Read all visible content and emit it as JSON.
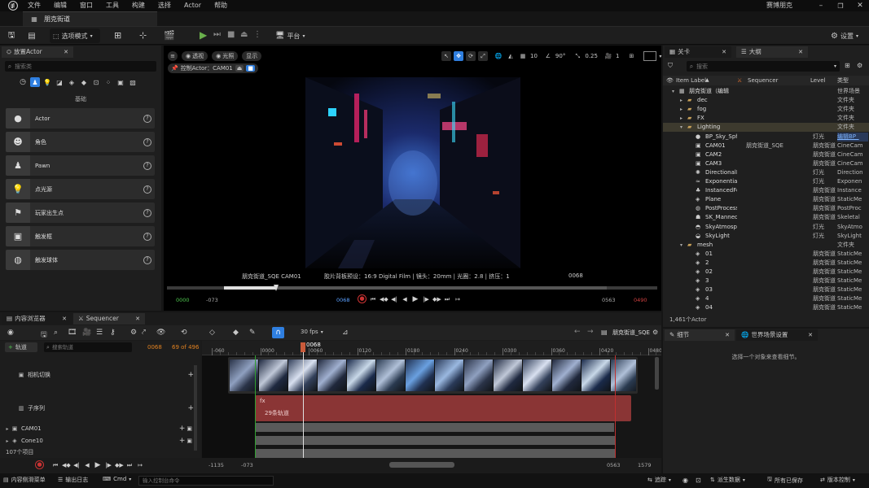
{
  "menu": [
    "文件",
    "编辑",
    "窗口",
    "工具",
    "构建",
    "选择",
    "Actor",
    "帮助"
  ],
  "project_name": "赛博朋克",
  "doc_tab": "朋克街道",
  "toolbar": {
    "mode": "选项模式",
    "platform": "平台",
    "settings": "设置"
  },
  "place_actor": {
    "tab": "放置Actor",
    "search_placeholder": "搜索类",
    "category": "基础",
    "items": [
      {
        "label": "Actor",
        "icon": "sphere-icon"
      },
      {
        "label": "角色",
        "icon": "character-icon"
      },
      {
        "label": "Pawn",
        "icon": "pawn-icon"
      },
      {
        "label": "点光源",
        "icon": "light-bulb-icon"
      },
      {
        "label": "玩家出生点",
        "icon": "player-start-icon"
      },
      {
        "label": "触发框",
        "icon": "trigger-box-icon"
      },
      {
        "label": "触发球体",
        "icon": "trigger-sphere-icon"
      }
    ]
  },
  "viewport": {
    "btn_perspective": "透视",
    "btn_lit": "光照",
    "btn_show": "显示",
    "grid_snap": "10",
    "rot_snap": "90°",
    "scale_snap": "0.25",
    "cam_speed": "1",
    "pilot_label": "控制Actor：CAM01",
    "cam_name": "朋克街道_SQE CAM01",
    "film_info": "胶片背板预设：16:9 Digital Film | 镜头：20mm | 光圈：2.8 | 挤压：1",
    "frame": "0068",
    "play_start": "0000",
    "play_in": "-073",
    "play_cur": "0068",
    "play_out": "0563",
    "play_end": "0490"
  },
  "outliner": {
    "tab_levels": "关卡",
    "tab_outliner": "大纲",
    "search_placeholder": "搜索",
    "col_label": "Item Label",
    "col_sequencer": "Sequencer",
    "col_level": "Level",
    "col_type": "类型",
    "rows": [
      {
        "indent": 0,
        "name": "朋克街道（编辑",
        "seq": "",
        "level": "",
        "type": "世界场景",
        "icon": "map-icon",
        "exp": "v"
      },
      {
        "indent": 1,
        "name": "dec",
        "seq": "",
        "level": "",
        "type": "文件夹",
        "icon": "folder-icon",
        "exp": ">"
      },
      {
        "indent": 1,
        "name": "fog",
        "seq": "",
        "level": "",
        "type": "文件夹",
        "icon": "folder-icon",
        "exp": ">"
      },
      {
        "indent": 1,
        "name": "FX",
        "seq": "",
        "level": "",
        "type": "文件夹",
        "icon": "folder-icon",
        "exp": ">"
      },
      {
        "indent": 1,
        "name": "Lighting",
        "seq": "",
        "level": "",
        "type": "文件夹",
        "icon": "folder-icon",
        "exp": "v",
        "sel": true
      },
      {
        "indent": 2,
        "name": "BP_Sky_Sph",
        "seq": "",
        "level": "灯光",
        "type": "编辑BP_",
        "icon": "sphere-icon",
        "exp": "",
        "link": true
      },
      {
        "indent": 2,
        "name": "CAM01",
        "seq": "朋克街道_SQE",
        "level": "朋克街道",
        "type": "CineCam",
        "icon": "camera-icon",
        "exp": ""
      },
      {
        "indent": 2,
        "name": "CAM2",
        "seq": "",
        "level": "朋克街道",
        "type": "CineCam",
        "icon": "camera-icon",
        "exp": ""
      },
      {
        "indent": 2,
        "name": "CAM3",
        "seq": "",
        "level": "朋克街道",
        "type": "CineCam",
        "icon": "camera-icon",
        "exp": ""
      },
      {
        "indent": 2,
        "name": "DirectionalLi",
        "seq": "",
        "level": "灯光",
        "type": "Direction",
        "icon": "sun-icon",
        "exp": ""
      },
      {
        "indent": 2,
        "name": "ExponentialH",
        "seq": "",
        "level": "灯光",
        "type": "Exponen",
        "icon": "fog-icon",
        "exp": ""
      },
      {
        "indent": 2,
        "name": "InstancedFo",
        "seq": "",
        "level": "朋克街道",
        "type": "Instance",
        "icon": "foliage-icon",
        "exp": ""
      },
      {
        "indent": 2,
        "name": "Plane",
        "seq": "",
        "level": "朋克街道",
        "type": "StaticMe",
        "icon": "mesh-icon",
        "exp": ""
      },
      {
        "indent": 2,
        "name": "PostProcess",
        "seq": "",
        "level": "朋克街道",
        "type": "PostProc",
        "icon": "postprocess-icon",
        "exp": ""
      },
      {
        "indent": 2,
        "name": "SK_Manneq",
        "seq": "",
        "level": "朋克街道",
        "type": "Skeletal",
        "icon": "skeletal-icon",
        "exp": ""
      },
      {
        "indent": 2,
        "name": "SkyAtmosph",
        "seq": "",
        "level": "灯光",
        "type": "SkyAtmo",
        "icon": "sky-icon",
        "exp": ""
      },
      {
        "indent": 2,
        "name": "SkyLight",
        "seq": "",
        "level": "灯光",
        "type": "SkyLight",
        "icon": "skylight-icon",
        "exp": ""
      },
      {
        "indent": 1,
        "name": "mesh",
        "seq": "",
        "level": "",
        "type": "文件夹",
        "icon": "folder-icon",
        "exp": "v"
      },
      {
        "indent": 2,
        "name": "01",
        "seq": "",
        "level": "朋克街道",
        "type": "StaticMe",
        "icon": "mesh-icon",
        "exp": ""
      },
      {
        "indent": 2,
        "name": "2",
        "seq": "",
        "level": "朋克街道",
        "type": "StaticMe",
        "icon": "mesh-icon",
        "exp": ""
      },
      {
        "indent": 2,
        "name": "02",
        "seq": "",
        "level": "朋克街道",
        "type": "StaticMe",
        "icon": "mesh-icon",
        "exp": ""
      },
      {
        "indent": 2,
        "name": "3",
        "seq": "",
        "level": "朋克街道",
        "type": "StaticMe",
        "icon": "mesh-icon",
        "exp": ""
      },
      {
        "indent": 2,
        "name": "03",
        "seq": "",
        "level": "朋克街道",
        "type": "StaticMe",
        "icon": "mesh-icon",
        "exp": ""
      },
      {
        "indent": 2,
        "name": "4",
        "seq": "",
        "level": "朋克街道",
        "type": "StaticMe",
        "icon": "mesh-icon",
        "exp": ""
      },
      {
        "indent": 2,
        "name": "04",
        "seq": "",
        "level": "朋克街道",
        "type": "StaticMe",
        "icon": "mesh-icon",
        "exp": ""
      }
    ],
    "count": "1,461个Actor"
  },
  "details": {
    "tab_details": "细节",
    "tab_world": "世界场景设置",
    "empty_msg": "选择一个对象来查看细节。"
  },
  "bottom_tabs": {
    "content_browser": "内容浏览器",
    "sequencer": "Sequencer"
  },
  "sequencer": {
    "fps": "30 fps",
    "seq_name": "朋克街道_SQE",
    "add_track": "轨道",
    "search_placeholder": "搜索轨道",
    "current_frame": "0068",
    "frame_count": "69 of 496",
    "ruler_ticks": [
      "-060",
      "0000",
      "0060",
      "0120",
      "0180",
      "0240",
      "0300",
      "0360",
      "0420",
      "0480",
      "0540"
    ],
    "playhead_label": "0068",
    "tracks": [
      {
        "label": "相机切换",
        "icon": "camera-cut-icon"
      },
      {
        "label": "子序列",
        "icon": "subsequence-icon"
      },
      {
        "label": "CAM01",
        "icon": "camera-icon"
      },
      {
        "label": "Cone10",
        "icon": "mesh-icon"
      }
    ],
    "items_count": "107个项目",
    "sub_label_fx": "fx",
    "sub_label_tracks": "29条轨道",
    "range_left": "-1135",
    "range_in": "-073",
    "range_out": "0563",
    "range_right": "1579"
  },
  "statusbar": {
    "drawer": "内容侧滑菜单",
    "output_log": "输出日志",
    "cmd": "Cmd",
    "cmd_placeholder": "输入控制台命令",
    "trace": "追踪",
    "derived": "派生数据",
    "saved": "所有已保存",
    "vcs": "版本控制"
  },
  "colors": {
    "accent": "#2f7fe0",
    "selection": "#3d3a2e",
    "folder": "#c9a25a",
    "subseq": "#8a3535"
  }
}
